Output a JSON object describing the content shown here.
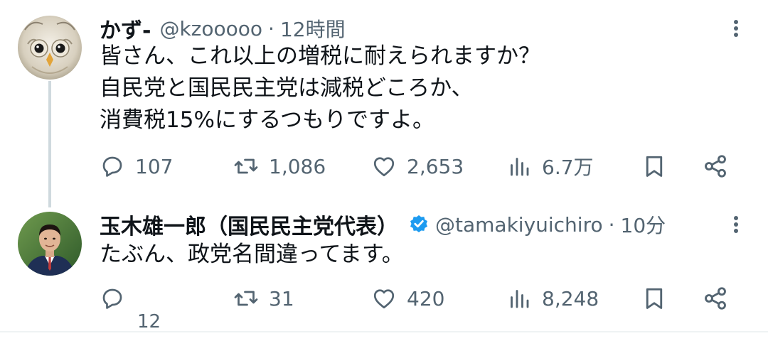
{
  "tweets": [
    {
      "author": {
        "display_name": "かず-",
        "handle": "@kzooooo",
        "verified": false,
        "avatar_icon": "owl-avatar"
      },
      "separator": "·",
      "time": "12時間",
      "text_lines": [
        "皆さん、これ以上の増税に耐えられますか？",
        "自民党と国民民主党は減税どころか、",
        "消費税15%にするつもりですよ。"
      ],
      "stats": {
        "replies": "107",
        "retweets": "1,086",
        "likes": "2,653",
        "views": "6.7万"
      }
    },
    {
      "author": {
        "display_name": "玉木雄一郎（国民民主党代表）",
        "handle": "@tamakiyuichiro",
        "verified": true,
        "avatar_icon": "person-avatar"
      },
      "separator": "·",
      "time": "10分",
      "text_lines": [
        "たぶん、政党名間違ってます。"
      ],
      "stats": {
        "replies": "12",
        "retweets": "31",
        "likes": "420",
        "views": "8,248"
      }
    }
  ],
  "icons": [
    "reply-icon",
    "retweet-icon",
    "like-icon",
    "views-icon",
    "bookmark-icon",
    "share-icon",
    "more-icon",
    "verified-badge-icon"
  ],
  "colors": {
    "text_primary": "#0f1419",
    "text_secondary": "#536471",
    "verified_blue": "#1d9bf0",
    "thread_line": "#cfd9de",
    "background": "#ffffff"
  }
}
